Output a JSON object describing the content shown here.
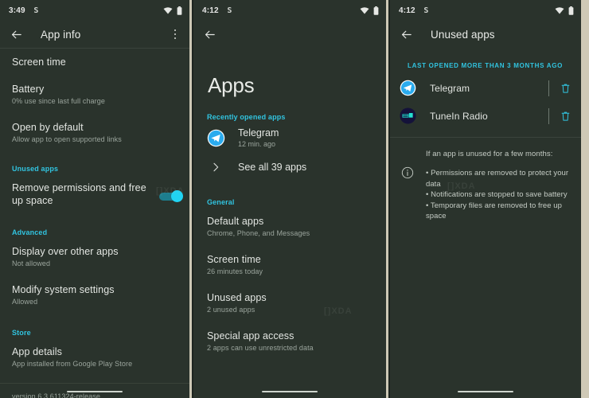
{
  "theme": {
    "background": "#2a332c",
    "accent": "#31c4e0",
    "text_primary": "#e3e6e2",
    "text_secondary": "#9ba59d",
    "divider": "#3a433c",
    "separator": "#cdc8b5"
  },
  "panel1": {
    "status_bar": {
      "time": "3:49",
      "glyph": "S",
      "wifi_icon": "wifi-icon",
      "battery_icon": "battery-icon"
    },
    "app_bar": {
      "back_icon": "back-arrow-icon",
      "title": "App info",
      "overflow_icon": "more-options-icon"
    },
    "rows": [
      {
        "title": "Screen time",
        "subtitle": ""
      },
      {
        "title": "Battery",
        "subtitle": "0% use since last full charge"
      },
      {
        "title": "Open by default",
        "subtitle": "Allow app to open supported links"
      }
    ],
    "unused_section": {
      "label": "Unused apps",
      "toggle_title": "Remove permissions and free up space",
      "toggle_on": true
    },
    "advanced_section": {
      "label": "Advanced",
      "rows": [
        {
          "title": "Display over other apps",
          "subtitle": "Not allowed"
        },
        {
          "title": "Modify system settings",
          "subtitle": "Allowed"
        }
      ]
    },
    "store_section": {
      "label": "Store",
      "rows": [
        {
          "title": "App details",
          "subtitle": "App installed from Google Play Store"
        }
      ]
    },
    "version": "version 6.3.611324-release",
    "watermark": "[]XDA"
  },
  "panel2": {
    "status_bar": {
      "time": "4:12",
      "glyph": "S",
      "wifi_icon": "wifi-icon",
      "battery_icon": "battery-icon"
    },
    "app_bar": {
      "back_icon": "back-arrow-icon",
      "title": ""
    },
    "page_title": "Apps",
    "recent_section": {
      "label": "Recently opened apps",
      "apps": [
        {
          "name": "Telegram",
          "time": "12 min. ago",
          "icon": "telegram-icon"
        }
      ],
      "see_all": "See all 39 apps",
      "see_all_icon": "chevron-right-icon"
    },
    "general_section": {
      "label": "General",
      "rows": [
        {
          "title": "Default apps",
          "subtitle": "Chrome, Phone, and Messages"
        },
        {
          "title": "Screen time",
          "subtitle": "26 minutes today"
        },
        {
          "title": "Unused apps",
          "subtitle": "2 unused apps"
        },
        {
          "title": "Special app access",
          "subtitle": "2 apps can use unrestricted data"
        }
      ]
    },
    "watermark": "[]XDA"
  },
  "panel3": {
    "status_bar": {
      "time": "4:12",
      "glyph": "S",
      "wifi_icon": "wifi-icon",
      "battery_icon": "battery-icon"
    },
    "app_bar": {
      "back_icon": "back-arrow-icon",
      "title": "Unused apps"
    },
    "section_label": "LAST OPENED MORE THAN 3 MONTHS AGO",
    "apps": [
      {
        "name": "Telegram",
        "icon": "telegram-icon",
        "delete_icon": "trash-icon"
      },
      {
        "name": "TuneIn Radio",
        "icon": "tunein-icon",
        "delete_icon": "trash-icon"
      }
    ],
    "info": {
      "icon": "info-icon",
      "lead": "If an app is unused for a few months:",
      "bullets": [
        "• Permissions are removed to protect your data",
        "• Notifications are stopped to save battery",
        "• Temporary files are removed to free up space"
      ]
    },
    "watermark": "[]XDA"
  }
}
